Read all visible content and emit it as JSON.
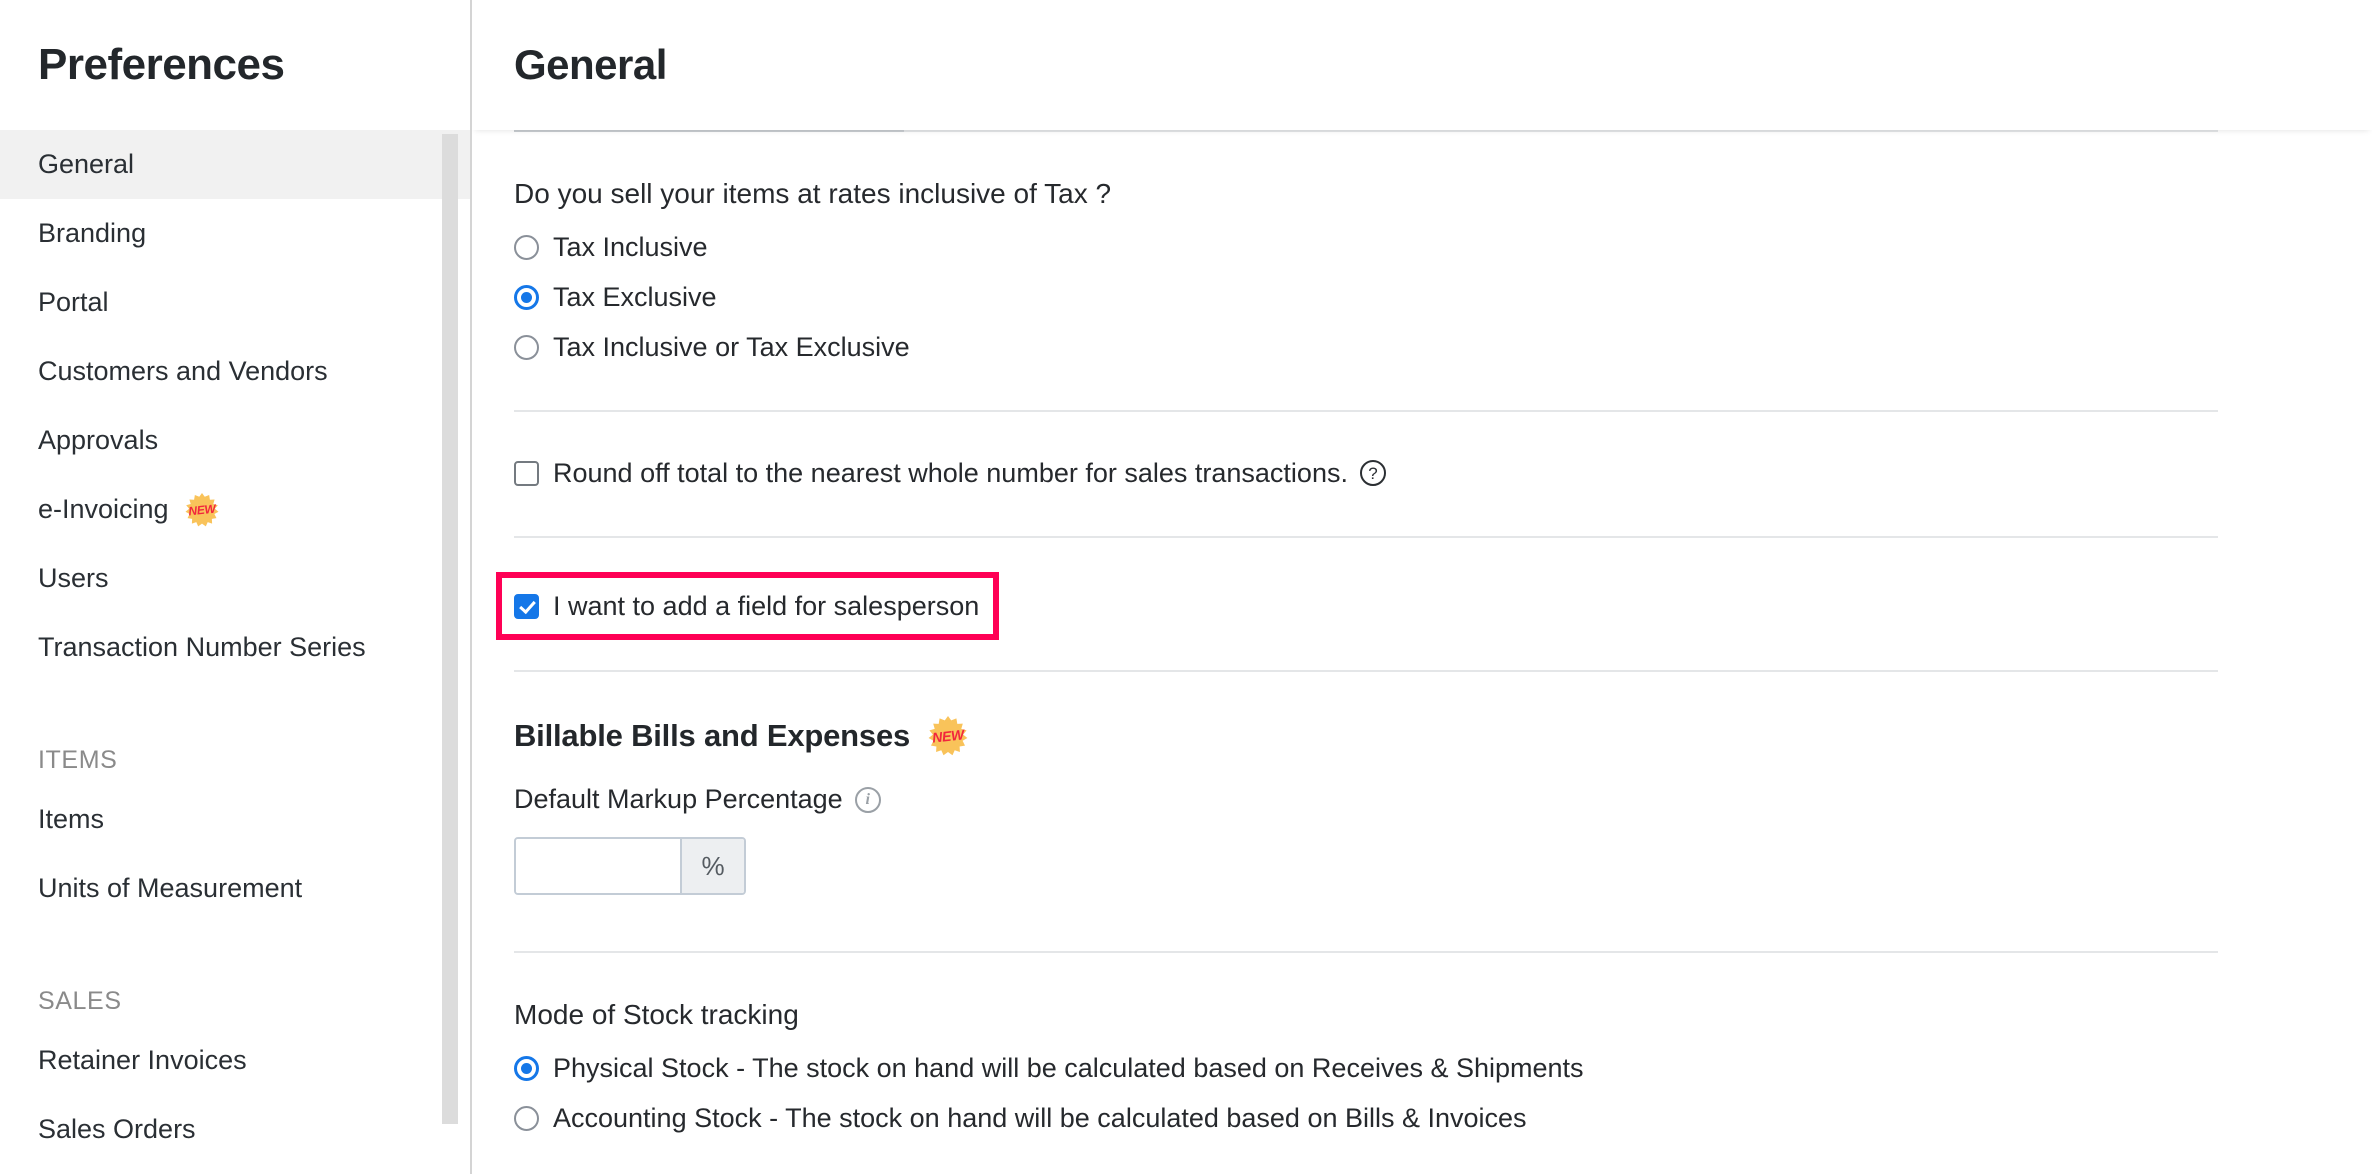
{
  "sidebar": {
    "title": "Preferences",
    "items": [
      {
        "label": "General",
        "active": true
      },
      {
        "label": "Branding",
        "active": false
      },
      {
        "label": "Portal",
        "active": false
      },
      {
        "label": "Customers and Vendors",
        "active": false
      },
      {
        "label": "Approvals",
        "active": false
      },
      {
        "label": "e-Invoicing",
        "active": false,
        "badge": "NEW"
      },
      {
        "label": "Users",
        "active": false
      },
      {
        "label": "Transaction Number Series",
        "active": false
      }
    ],
    "sections": [
      {
        "heading": "ITEMS",
        "items": [
          {
            "label": "Items"
          },
          {
            "label": "Units of Measurement"
          }
        ]
      },
      {
        "heading": "SALES",
        "items": [
          {
            "label": "Retainer Invoices"
          },
          {
            "label": "Sales Orders"
          }
        ]
      }
    ]
  },
  "main": {
    "title": "General",
    "tax_question": {
      "label": "Do you sell your items at rates inclusive of Tax ?",
      "options": [
        {
          "label": "Tax Inclusive",
          "selected": false
        },
        {
          "label": "Tax Exclusive",
          "selected": true
        },
        {
          "label": "Tax Inclusive or Tax Exclusive",
          "selected": false
        }
      ]
    },
    "round_off": {
      "label": "Round off total to the nearest whole number for sales transactions.",
      "checked": false,
      "help_icon": "help-circle-icon",
      "help_glyph": "?"
    },
    "salesperson": {
      "label": "I want to add a field for salesperson",
      "checked": true,
      "highlighted": true,
      "highlight_color": "#ff0055"
    },
    "billable": {
      "heading": "Billable Bills and Expenses",
      "badge": "NEW",
      "field_label": "Default Markup Percentage",
      "info_icon": "info-circle-icon",
      "info_glyph": "i",
      "input_value": "",
      "input_placeholder": "",
      "suffix": "%"
    },
    "stock_tracking": {
      "label": "Mode of Stock tracking",
      "options": [
        {
          "label": "Physical Stock - The stock on hand will be calculated based on Receives & Shipments",
          "selected": true
        },
        {
          "label": "Accounting Stock - The stock on hand will be calculated based on Bills & Invoices",
          "selected": false
        }
      ]
    }
  },
  "colors": {
    "accent_blue": "#1577e8",
    "highlight_pink": "#ff0055",
    "badge_orange": "#f9c35a",
    "badge_text_red": "#f1263d",
    "active_nav_bg": "#f1f1f1"
  }
}
